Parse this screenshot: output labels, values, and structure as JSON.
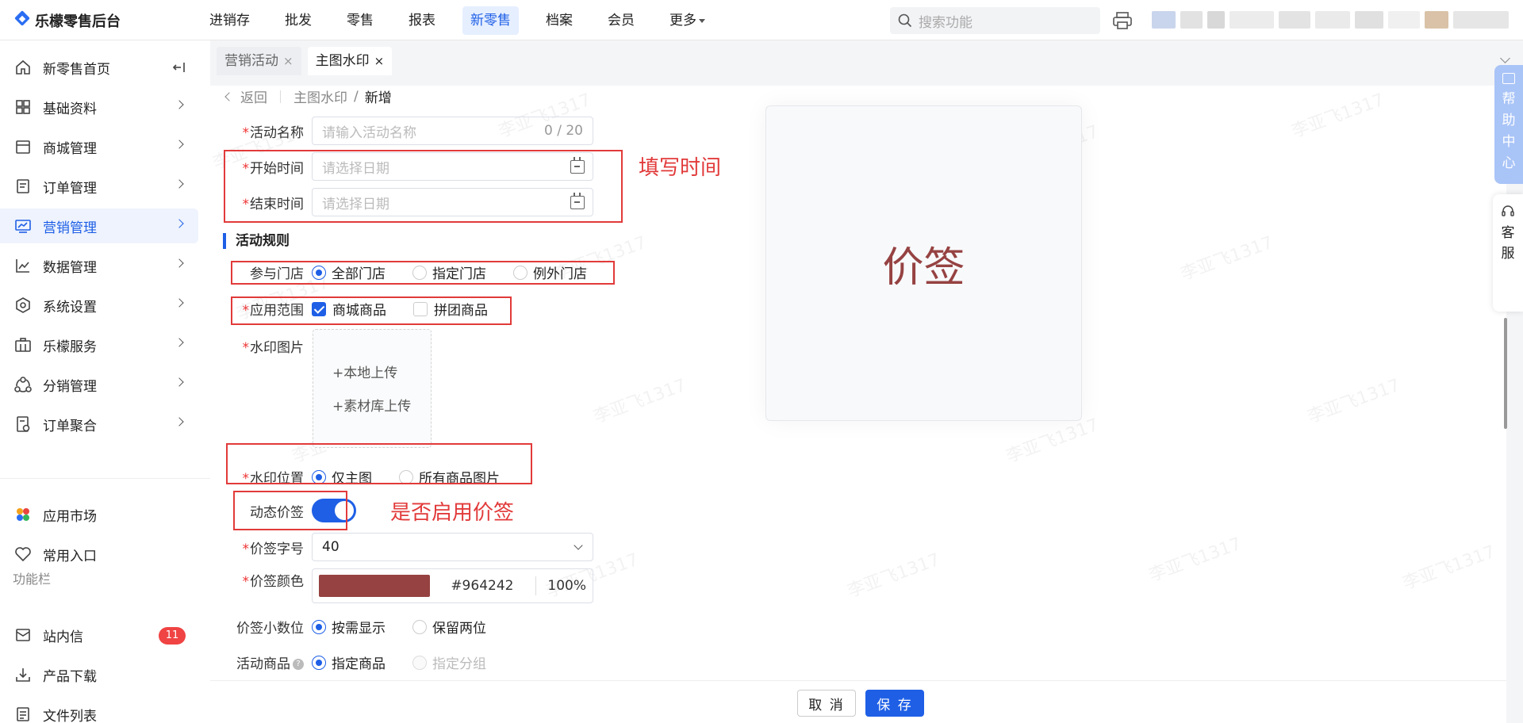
{
  "app": {
    "logo_text": "乐檬零售后台"
  },
  "topnav": {
    "items": [
      "进销存",
      "批发",
      "零售",
      "报表",
      "新零售",
      "档案",
      "会员",
      "更多"
    ],
    "active": "新零售"
  },
  "search": {
    "placeholder": "搜索功能"
  },
  "sidebar": {
    "items": [
      {
        "label": "新零售首页",
        "icon": "home-icon"
      },
      {
        "label": "基础资料",
        "icon": "grid-icon"
      },
      {
        "label": "商城管理",
        "icon": "store-icon"
      },
      {
        "label": "订单管理",
        "icon": "order-icon"
      },
      {
        "label": "营销管理",
        "icon": "monitor-icon"
      },
      {
        "label": "数据管理",
        "icon": "chart-line-icon"
      },
      {
        "label": "系统设置",
        "icon": "settings-icon"
      },
      {
        "label": "乐檬服务",
        "icon": "briefcase-icon"
      },
      {
        "label": "分销管理",
        "icon": "share-icon"
      },
      {
        "label": "订单聚合",
        "icon": "doc-icon"
      }
    ],
    "active": "营销管理",
    "extra": [
      {
        "label": "应用市场",
        "icon": "app-market-icon"
      },
      {
        "label": "常用入口",
        "icon": "heart-icon"
      }
    ],
    "group_label": "功能栏",
    "tools": [
      {
        "label": "站内信",
        "icon": "mail-icon",
        "badge": "11"
      },
      {
        "label": "产品下载",
        "icon": "download-icon"
      },
      {
        "label": "文件列表",
        "icon": "file-list-icon"
      }
    ]
  },
  "tabs": [
    {
      "label": "营销活动",
      "close": "×"
    },
    {
      "label": "主图水印",
      "close": "×"
    }
  ],
  "breadcrumb": {
    "back": "返回",
    "parent": "主图水印",
    "sep": "/",
    "current": "新增"
  },
  "form": {
    "activity_name": {
      "label": "活动名称",
      "placeholder": "请输入活动名称",
      "counter": "0 / 20"
    },
    "start_time": {
      "label": "开始时间",
      "placeholder": "请选择日期"
    },
    "end_time": {
      "label": "结束时间",
      "placeholder": "请选择日期"
    },
    "section_rules": "活动规则",
    "stores": {
      "label": "参与门店",
      "options": [
        "全部门店",
        "指定门店",
        "例外门店"
      ],
      "selected": "全部门店"
    },
    "scope": {
      "label": "应用范围",
      "options": [
        "商城商品",
        "拼团商品"
      ],
      "checked": [
        "商城商品"
      ]
    },
    "watermark_image": {
      "label": "水印图片",
      "local_upload": "+本地上传",
      "library_upload": "+素材库上传"
    },
    "watermark_position": {
      "label": "水印位置",
      "options": [
        "仅主图",
        "所有商品图片"
      ],
      "selected": "仅主图"
    },
    "dynamic_price": {
      "label": "动态价签",
      "enabled": true
    },
    "price_font_size": {
      "label": "价签字号",
      "value": "40"
    },
    "price_color": {
      "label": "价签颜色",
      "hex": "#964242",
      "opacity": "100%"
    },
    "price_decimal": {
      "label": "价签小数位",
      "options": [
        "按需显示",
        "保留两位"
      ],
      "selected": "按需显示"
    },
    "activity_goods": {
      "label": "活动商品",
      "help": "?",
      "options": [
        "指定商品",
        "指定分组"
      ],
      "selected": "指定商品"
    }
  },
  "annotations": {
    "time": "填写时间",
    "price": "是否启用价签"
  },
  "preview": {
    "text": "价签",
    "color": "#964242"
  },
  "footer": {
    "cancel": "取 消",
    "save": "保 存"
  },
  "side_tabs": {
    "help": [
      "帮",
      "助",
      "中",
      "心"
    ],
    "service": [
      "客",
      "服"
    ]
  },
  "watermark_text": "李亚飞1317",
  "colors": {
    "accent": "#1e5fe6",
    "annotation": "#e23a3a",
    "badge": "#f04343"
  }
}
